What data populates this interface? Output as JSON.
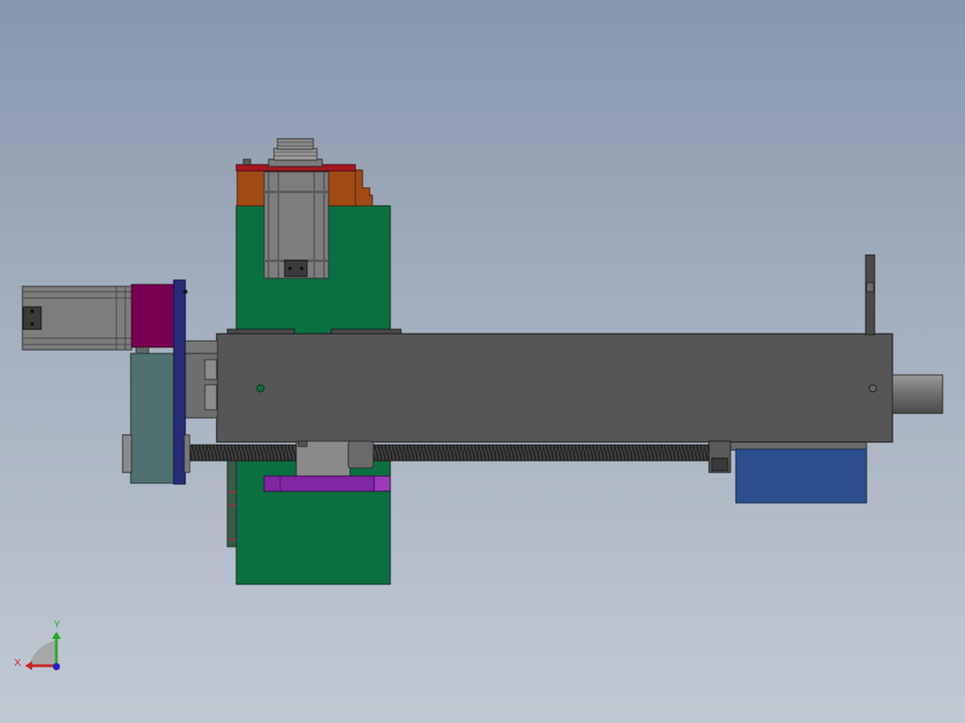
{
  "view": {
    "background_top": "#8797ab",
    "background_bottom": "#c1c9d3"
  },
  "triad": {
    "x_label": "X",
    "y_label": "Y",
    "x_color": "#cc2222",
    "y_color": "#22aa22",
    "z_color": "#2222cc"
  },
  "colors": {
    "frame_green": "#0b7040",
    "rail_gray": "#565656",
    "motor_gray": "#7d7d7d",
    "coupler_magenta": "#790052",
    "plate_navy": "#272c78",
    "gear_teal": "#4f7270",
    "block_blue": "#2c4e8f",
    "bracket_purple": "#8127a3",
    "mount_orange": "#a14a14",
    "top_red": "#a31722"
  }
}
